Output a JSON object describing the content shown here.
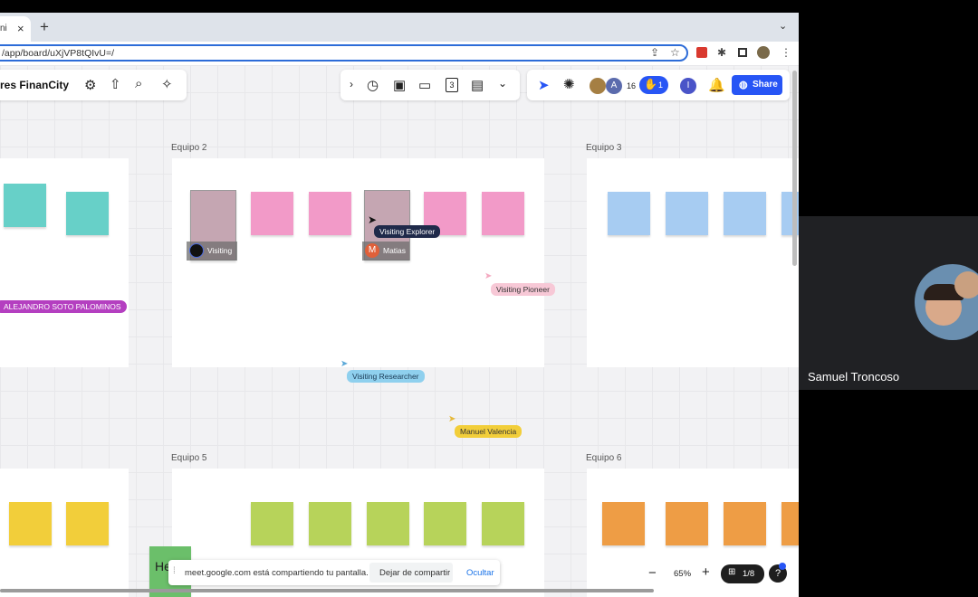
{
  "browser": {
    "tab_partial": "ni",
    "tab_close": "×",
    "new_tab": "+",
    "url": "/app/board/uXjVP8tQIvU=/"
  },
  "board": {
    "title_partial": "res FinanCity",
    "participant_count": "16",
    "hand_count": "1",
    "share_label": "Share",
    "toolbar_number": "3",
    "frames": [
      {
        "label": "Equipo 2"
      },
      {
        "label": "Equipo 3"
      },
      {
        "label": "Equipo 5"
      },
      {
        "label": "Equipo 6"
      }
    ],
    "name_tags": {
      "alejandro": "ALEJANDRO SOTO PALOMINOS",
      "visiting": "Visiting",
      "matias": "Matias"
    },
    "cursors": {
      "explorer": "Visiting Explorer",
      "pioneer": "Visiting Pioneer",
      "researcher": "Visiting Researcher",
      "manuel": "Manuel Valencia"
    },
    "zoom": "65%",
    "page_indicator": "1/8",
    "partial_note": "He"
  },
  "meet": {
    "sharing_text": "meet.google.com está compartiendo tu pantalla.",
    "stop_label": "Dejar de compartir",
    "hide_label": "Ocultar"
  },
  "video": {
    "participant_name": "Samuel Troncoso"
  },
  "colors": {
    "teal": "#67d0c8",
    "pink": "#f29ac8",
    "grey_note": "#c5a6b2",
    "blue": "#a7ccf2",
    "yellow": "#f2ce3a",
    "green": "#b7d35a",
    "orange": "#ee9d45",
    "share_blue": "#2755f5",
    "magenta_tag": "#b43fc0"
  }
}
